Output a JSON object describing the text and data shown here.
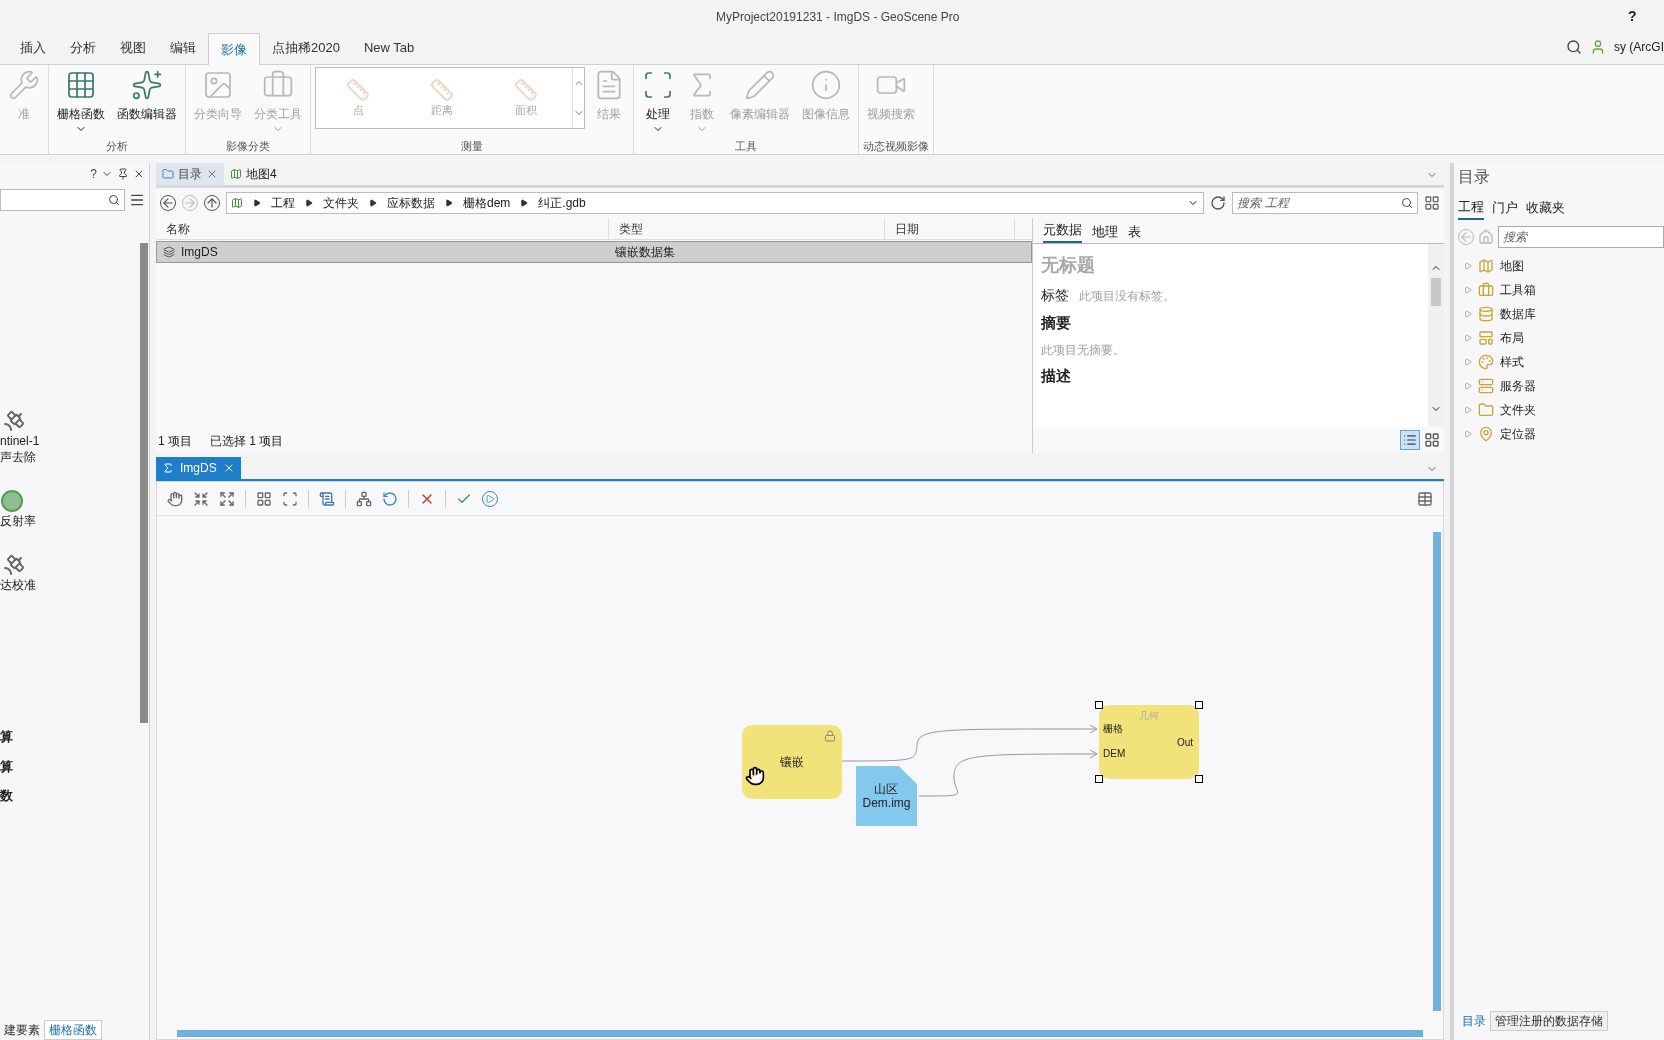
{
  "window": {
    "title": "MyProject20191231 - ImgDS - GeoScene Pro",
    "help": "?"
  },
  "ribbon_tabs": [
    {
      "label": "插入",
      "selected": false
    },
    {
      "label": "分析",
      "selected": false
    },
    {
      "label": "视图",
      "selected": false
    },
    {
      "label": "编辑",
      "selected": false
    },
    {
      "label": "影像",
      "selected": true
    },
    {
      "label": "点抽稀2020",
      "selected": false
    },
    {
      "label": "New Tab",
      "selected": false
    }
  ],
  "account": {
    "user": "sy (ArcGI"
  },
  "ribbon_groups": [
    {
      "buttons": [
        {
          "label": "准",
          "disabled": true,
          "dropdown": false
        }
      ]
    },
    {
      "label": "分析",
      "buttons": [
        {
          "label": "栅格函数",
          "disabled": false,
          "dropdown": true
        },
        {
          "label": "函数编辑器",
          "disabled": false,
          "dropdown": false
        }
      ]
    },
    {
      "label": "影像分类",
      "buttons": [
        {
          "label": "分类向导",
          "disabled": true,
          "dropdown": false
        },
        {
          "label": "分类工具",
          "disabled": true,
          "dropdown": true
        }
      ]
    },
    {
      "label": "测量",
      "gallery": [
        "点",
        "距离",
        "面积"
      ],
      "buttons": [
        {
          "label": "结果",
          "disabled": true,
          "dropdown": false
        }
      ]
    },
    {
      "label": "工具",
      "buttons": [
        {
          "label": "处理",
          "disabled": false,
          "dropdown": true
        },
        {
          "label": "指数",
          "disabled": true,
          "dropdown": true
        },
        {
          "label": "像素编辑器",
          "disabled": true,
          "dropdown": false
        },
        {
          "label": "图像信息",
          "disabled": true,
          "dropdown": false
        }
      ]
    },
    {
      "label": "动态视频影像",
      "buttons": [
        {
          "label": "视频搜索",
          "disabled": true,
          "dropdown": false
        }
      ]
    }
  ],
  "left_panel": {
    "help": "?",
    "tools": [
      {
        "lines": [
          "ntinel-1",
          "声去除"
        ]
      },
      {
        "lines": [
          "反射率"
        ]
      },
      {
        "lines": [
          "达校准"
        ]
      }
    ],
    "functions": [
      "算",
      "算",
      "数"
    ],
    "tabs": [
      {
        "label": "建要素",
        "selected": false
      },
      {
        "label": "栅格函数",
        "selected": true
      }
    ]
  },
  "catalog_view": {
    "tabs": [
      {
        "label": "目录",
        "selected": true
      },
      {
        "label": "地图4",
        "selected": false
      }
    ],
    "breadcrumb": [
      "工程",
      "文件夹",
      "应标数据",
      "栅格dem",
      "纠正.gdb"
    ],
    "search": {
      "placeholder": "搜索 工程"
    },
    "columns": [
      "名称",
      "类型",
      "日期"
    ],
    "rows": [
      {
        "name": "ImgDS",
        "type": "镶嵌数据集",
        "selected": true
      }
    ],
    "status": [
      "1 项目",
      "已选择 1 项目"
    ],
    "details_tabs": [
      {
        "label": "元数据",
        "selected": true
      },
      {
        "label": "地理",
        "selected": false
      },
      {
        "label": "表",
        "selected": false
      }
    ],
    "metadata": [
      {
        "kind": "title",
        "text": "无标题"
      },
      {
        "kind": "field",
        "label": "标签",
        "text": "此项目没有标签。"
      },
      {
        "kind": "heading",
        "text": "摘要"
      },
      {
        "kind": "note",
        "text": "此项目无摘要。"
      },
      {
        "kind": "heading",
        "text": "描述"
      }
    ]
  },
  "model_view": {
    "tab": "ImgDS",
    "nodes": [
      {
        "kind": "function",
        "label": "镶嵌",
        "locked": true,
        "selected": false
      },
      {
        "kind": "data",
        "label": "山区\nDem.img",
        "selected": false
      },
      {
        "kind": "function",
        "label": "几何",
        "inputs": [
          "栅格",
          "DEM"
        ],
        "output": "Out",
        "locked": false,
        "selected": true
      }
    ]
  },
  "catalog_pane": {
    "title": "目录",
    "tabs": [
      {
        "label": "工程",
        "selected": true
      },
      {
        "label": "门户",
        "selected": false
      },
      {
        "label": "收藏夹",
        "selected": false
      }
    ],
    "search": {
      "placeholder": "搜索"
    },
    "items": [
      {
        "label": "地图",
        "expanded": false
      },
      {
        "label": "工具箱",
        "expanded": false
      },
      {
        "label": "数据库",
        "expanded": false
      },
      {
        "label": "布局",
        "expanded": false
      },
      {
        "label": "样式",
        "expanded": false
      },
      {
        "label": "服务器",
        "expanded": false
      },
      {
        "label": "文件夹",
        "expanded": false
      },
      {
        "label": "定位器",
        "expanded": false
      }
    ],
    "bottom_tabs": [
      {
        "label": "目录",
        "selected": true
      },
      {
        "label": "管理注册的数据存储",
        "selected": false
      }
    ]
  }
}
